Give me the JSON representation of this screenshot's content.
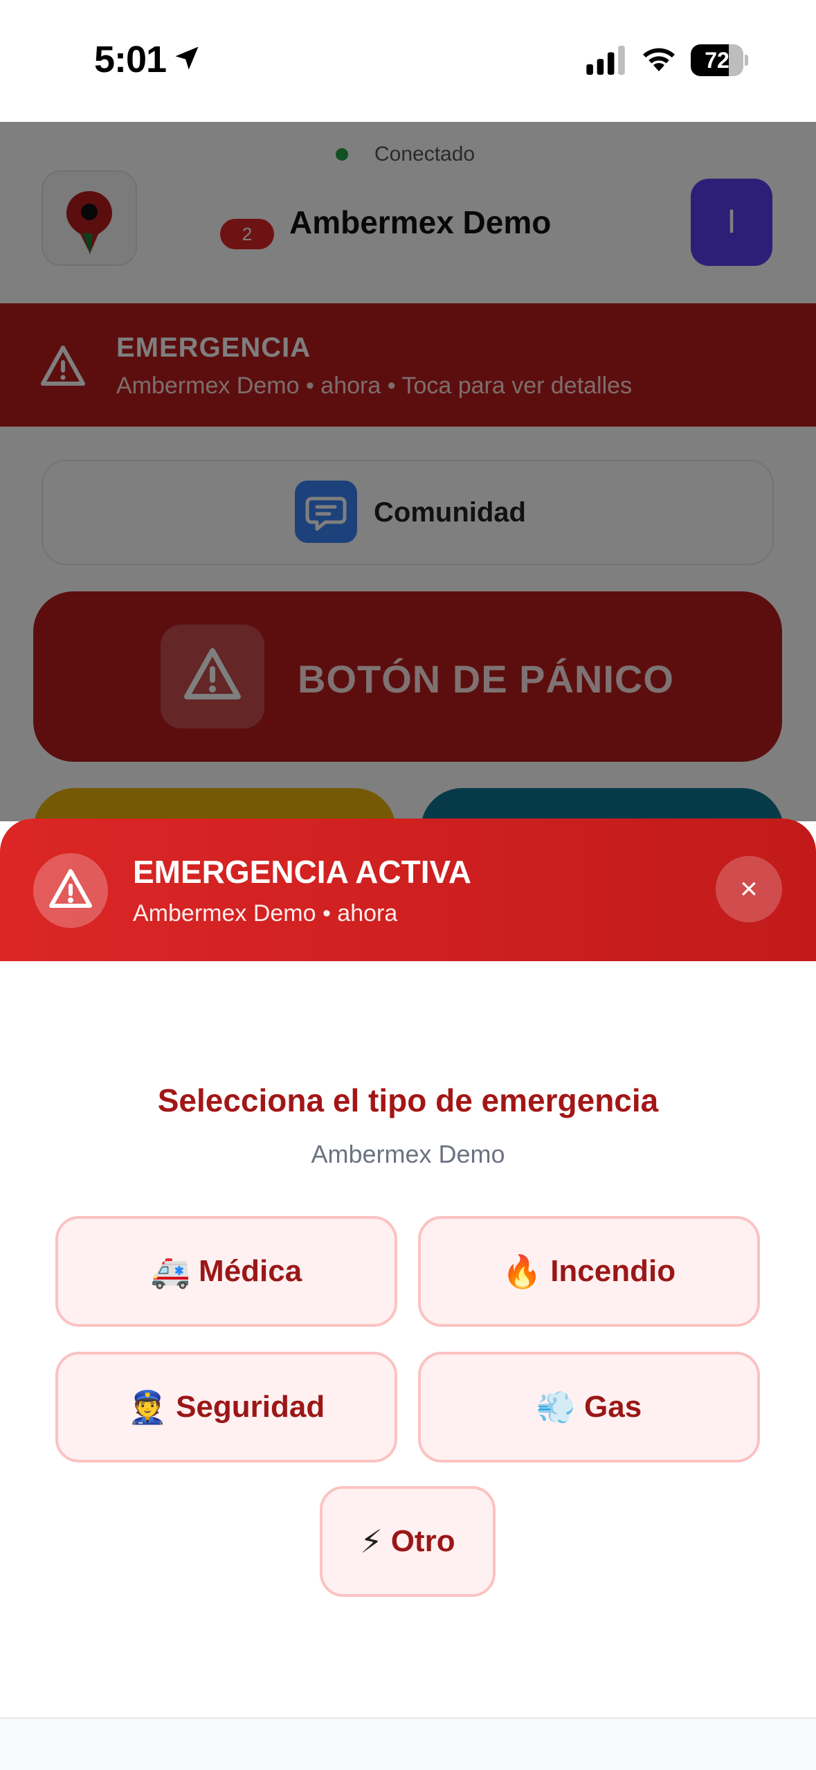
{
  "status_bar": {
    "time": "5:01",
    "battery": "72",
    "battery_level": 0.72,
    "icons": [
      "location-arrow-icon",
      "signal-icon",
      "wifi-icon",
      "battery-icon"
    ]
  },
  "header": {
    "connection_status": "Conectado",
    "connection_color": "#22a34a",
    "badge_count": "2",
    "title": "Ambermex Demo",
    "avatar_initial": "I",
    "avatar_color": "#5b3ff0"
  },
  "alert_banner": {
    "title": "EMERGENCIA",
    "subtitle": "Ambermex Demo • ahora • Toca para ver detalles",
    "color": "#b91c1c"
  },
  "community": {
    "label": "Comunidad",
    "icon": "chat-icon"
  },
  "panic": {
    "label": "BOTÓN DE PÁNICO",
    "icon": "warning-icon",
    "color": "#b91c1c"
  },
  "sheet": {
    "header_title": "EMERGENCIA ACTIVA",
    "header_subtitle": "Ambermex Demo • ahora",
    "close_icon": "×",
    "prompt": "Selecciona el tipo de emergencia",
    "group": "Ambermex Demo",
    "options": [
      {
        "emoji": "🚑",
        "label": "Médica"
      },
      {
        "emoji": "🔥",
        "label": "Incendio"
      },
      {
        "emoji": "👮",
        "label": "Seguridad"
      },
      {
        "emoji": "💨",
        "label": "Gas"
      },
      {
        "emoji": "⚡",
        "label": "Otro"
      }
    ]
  }
}
